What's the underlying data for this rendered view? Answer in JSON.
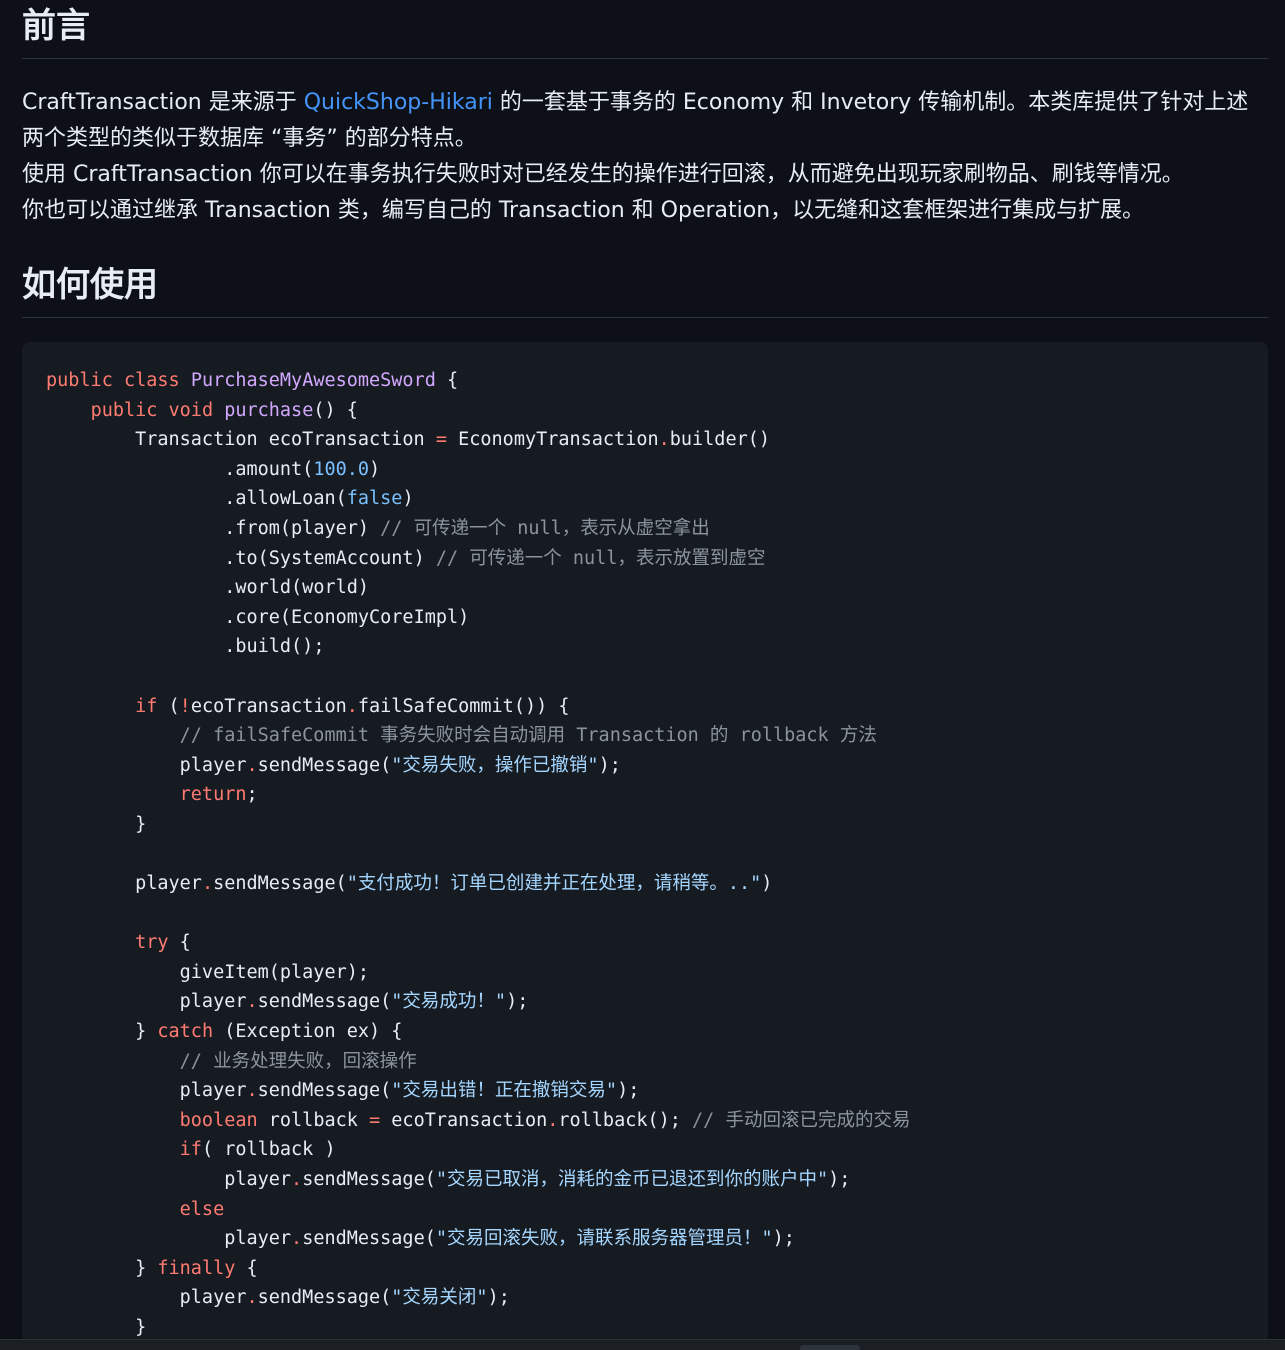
{
  "sections": {
    "preface": {
      "heading": "前言",
      "p1_a": "CraftTransaction 是来源于 ",
      "p1_link": "QuickShop-Hikari",
      "p1_b": " 的一套基于事务的 Economy 和 Invetory 传输机制。本类库提供了针对上述两个类型的类似于数据库 “事务” 的部分特点。",
      "p2": "使用 CraftTransaction 你可以在事务执行失败时对已经发生的操作进行回滚，从而避免出现玩家刷物品、刷钱等情况。",
      "p3": "你也可以通过继承 Transaction 类，编写自己的 Transaction 和 Operation，以无缝和这套框架进行集成与扩展。"
    },
    "usage": {
      "heading": "如何使用"
    }
  },
  "code": {
    "kw_public": "public",
    "kw_class": "class",
    "class_name": "PurchaseMyAwesomeSword",
    "kw_void": "void",
    "method_name": "purchase",
    "line3_a": "Transaction ecoTransaction ",
    "line3_b": "EconomyTransaction",
    "line3_c": "builder()",
    "amount": ".amount(",
    "amount_val": "100.0",
    "allow_loan": ".allowLoan(",
    "false_val": "false",
    "from": ".from(player) ",
    "from_cmt": "// 可传递一个 null，表示从虚空拿出",
    "to": ".to(SystemAccount) ",
    "to_cmt": "// 可传递一个 null，表示放置到虚空",
    "world": ".world(world)",
    "core": ".core(EconomyCoreImpl)",
    "build": ".build();",
    "kw_if": "if",
    "if_cond_a": "ecoTransaction",
    "if_cond_b": "failSafeCommit()) {",
    "cmt_failsafe": "// failSafeCommit 事务失败时会自动调用 Transaction 的 rollback 方法",
    "player": "player",
    "send": "sendMessage(",
    "msg_fail": "\"交易失败，操作已撤销\"",
    "kw_return": "return",
    "msg_paid": "\"支付成功！订单已创建并正在处理，请稍等。..\"",
    "kw_try": "try",
    "give_item": "giveItem(player);",
    "msg_success": "\"交易成功！\"",
    "kw_catch": "catch",
    "catch_args": "(Exception ex) {",
    "cmt_rollback": "// 业务处理失败，回滚操作",
    "msg_error": "\"交易出错！正在撤销交易\"",
    "kw_boolean": "boolean",
    "rollback_var": " rollback ",
    "rollback_call_a": " ecoTransaction",
    "rollback_call_b": "rollback(); ",
    "cmt_manual": "// 手动回滚已完成的交易",
    "if_rollback": "( rollback )",
    "msg_cancelled": "\"交易已取消，消耗的金币已退还到你的账户中\"",
    "kw_else": "else",
    "msg_rollback_fail": "\"交易回滚失败，请联系服务器管理员！\"",
    "kw_finally": "finally",
    "msg_closed": "\"交易关闭\""
  },
  "colors": {
    "background": "#0d1117",
    "code_background": "#161b22",
    "link": "#4493f8",
    "keyword": "#ff7b72",
    "class_name": "#d2a8ff",
    "number": "#79c0ff",
    "string": "#a5d6ff",
    "comment": "#8b949e"
  }
}
